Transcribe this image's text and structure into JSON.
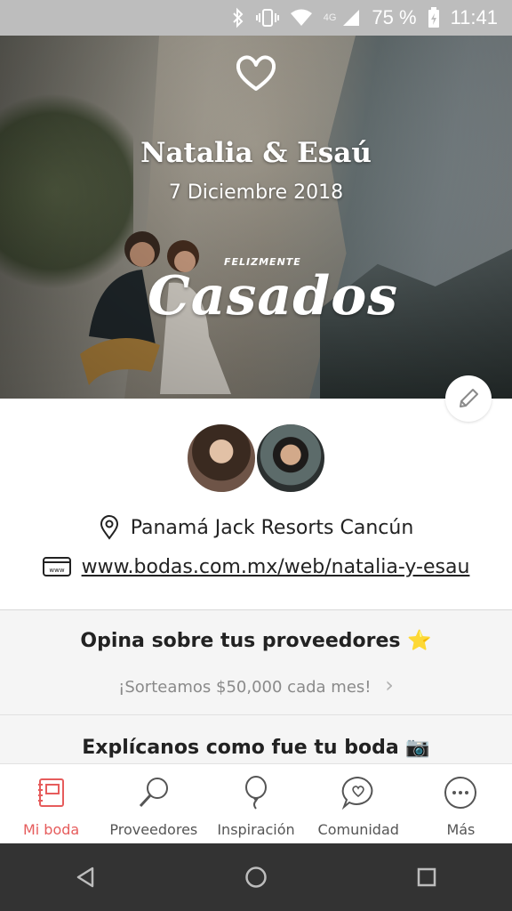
{
  "status_bar": {
    "network": "4G",
    "battery": "75 %",
    "time": "11:41",
    "icons": [
      "bluetooth-icon",
      "vibrate-icon",
      "wifi-icon",
      "signal-icon",
      "battery-icon"
    ]
  },
  "hero": {
    "names": "Natalia & Esaú",
    "date": "7 Diciembre 2018",
    "stamp_top": "FELIZMENTE",
    "stamp_main": "Casados"
  },
  "wedding": {
    "venue": "Panamá Jack Resorts Cancún",
    "website": "www.bodas.com.mx/web/natalia-y-esau"
  },
  "promo": {
    "title": "Opina sobre tus proveedores",
    "title_emoji": "⭐",
    "subtitle": "¡Sorteamos $50,000 cada mes!",
    "chevron": "›"
  },
  "story": {
    "title": "Explícanos como fue tu boda",
    "title_emoji": "📷"
  },
  "tabs": [
    {
      "label": "Mi boda",
      "icon": "notebook-icon",
      "active": true
    },
    {
      "label": "Proveedores",
      "icon": "magnifier-icon",
      "active": false
    },
    {
      "label": "Inspiración",
      "icon": "balloon-icon",
      "active": false
    },
    {
      "label": "Comunidad",
      "icon": "chat-heart-icon",
      "active": false
    },
    {
      "label": "Más",
      "icon": "more-icon",
      "active": false
    }
  ],
  "colors": {
    "accent": "#e65c5c",
    "nav_background": "#333333",
    "status_bar": "#bdbdbd"
  }
}
